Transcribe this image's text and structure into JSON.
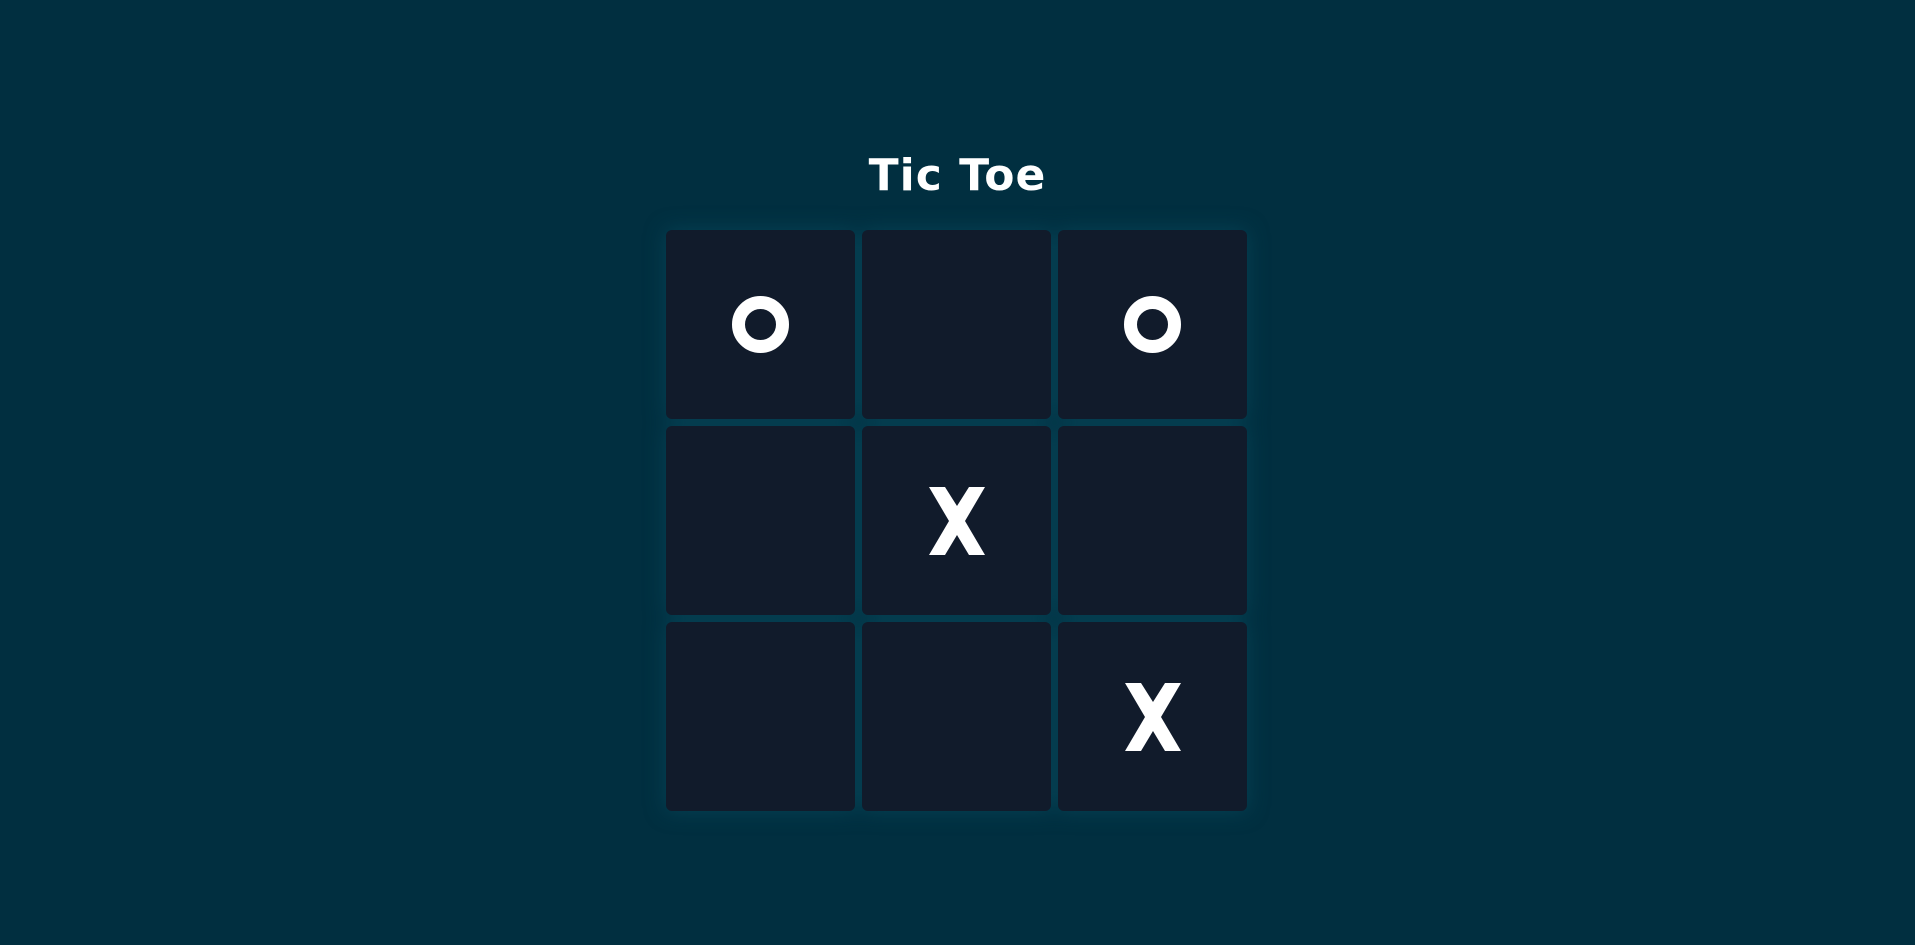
{
  "title": "Tic Toe",
  "colors": {
    "background": "#012f40",
    "cell": "#111b2b",
    "mark": "#ffffff"
  },
  "board": {
    "cells": [
      {
        "index": 0,
        "value": "O"
      },
      {
        "index": 1,
        "value": ""
      },
      {
        "index": 2,
        "value": "O"
      },
      {
        "index": 3,
        "value": ""
      },
      {
        "index": 4,
        "value": "X"
      },
      {
        "index": 5,
        "value": ""
      },
      {
        "index": 6,
        "value": ""
      },
      {
        "index": 7,
        "value": ""
      },
      {
        "index": 8,
        "value": "X"
      }
    ]
  }
}
